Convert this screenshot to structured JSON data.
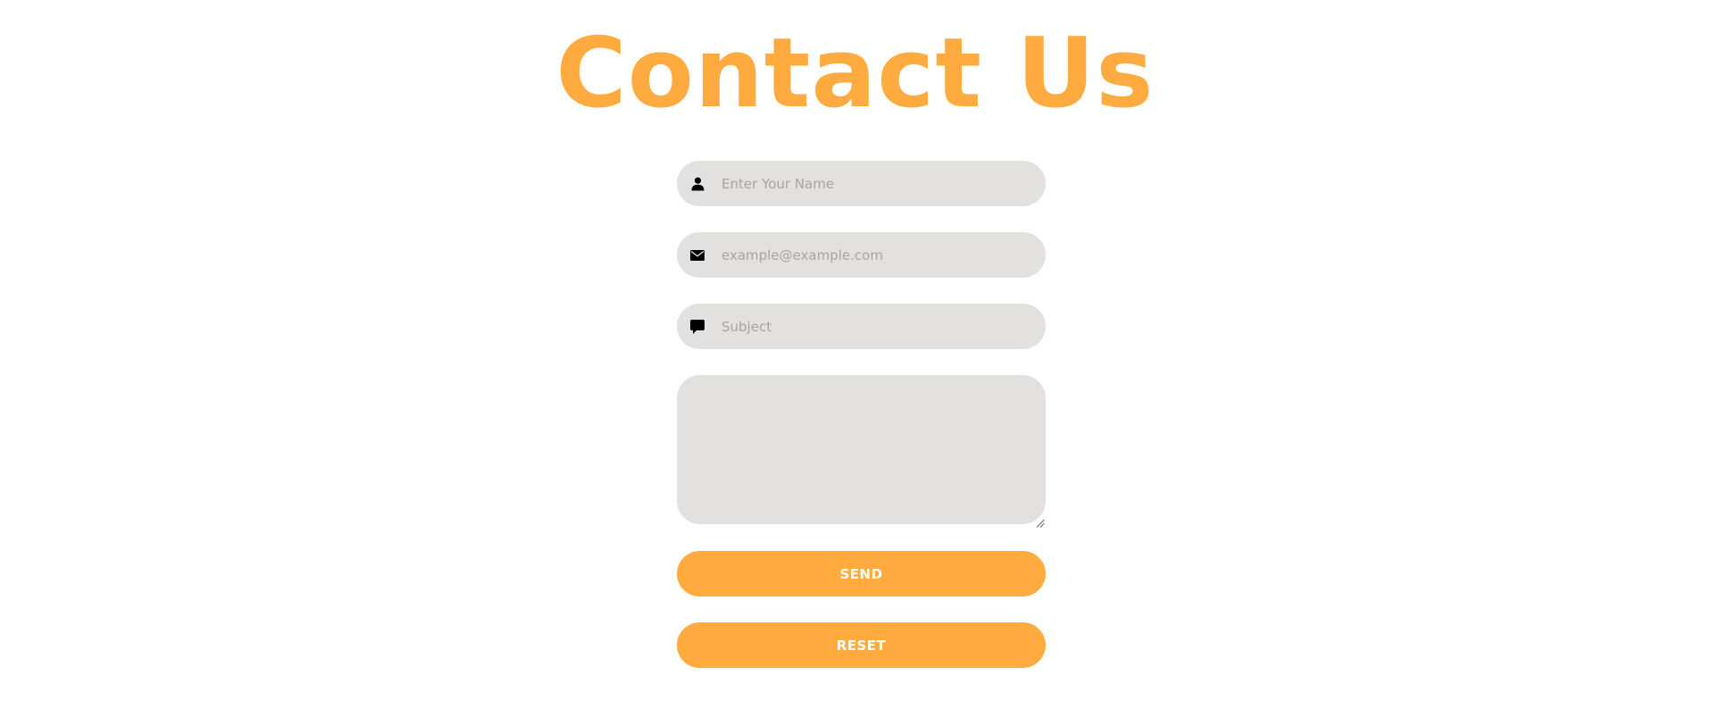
{
  "page": {
    "title": "Contact Us"
  },
  "form": {
    "name": {
      "placeholder": "Enter Your Name",
      "value": "",
      "icon": "user-icon"
    },
    "email": {
      "placeholder": "example@example.com",
      "value": "",
      "icon": "envelope-icon"
    },
    "subject": {
      "placeholder": "Subject",
      "value": "",
      "icon": "speech-bubble-icon"
    },
    "message": {
      "placeholder": "",
      "value": ""
    },
    "send_label": "SEND",
    "reset_label": "RESET"
  },
  "colors": {
    "accent": "#ffab40",
    "field_background": "#e3e0e0",
    "placeholder": "#a8a4a4",
    "button_text": "#ffffff"
  }
}
